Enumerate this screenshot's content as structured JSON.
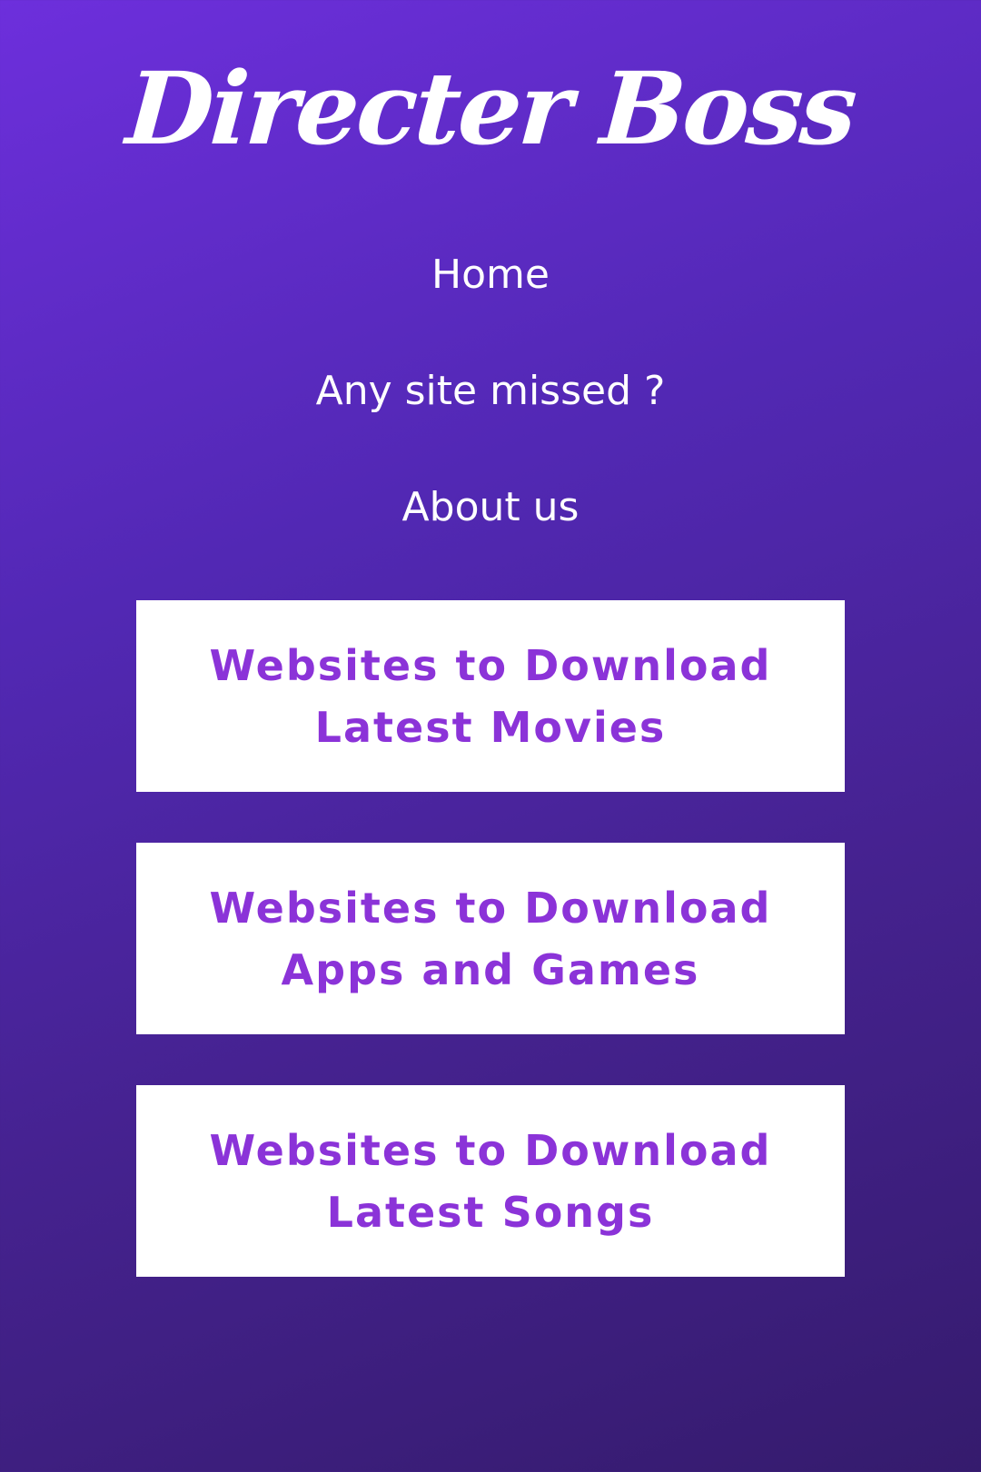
{
  "brand": {
    "title": "Directer Boss"
  },
  "nav": {
    "items": [
      {
        "label": "Home"
      },
      {
        "label": "Any site missed ?"
      },
      {
        "label": "About us"
      }
    ]
  },
  "cards": [
    {
      "label": "Websites to Download Latest Movies"
    },
    {
      "label": "Websites to Download Apps and Games"
    },
    {
      "label": "Websites to Download Latest Songs"
    }
  ],
  "colors": {
    "background_start": "#6d2fdc",
    "background_end": "#351b6d",
    "card_background": "#ffffff",
    "card_text": "#8b33d8",
    "nav_text": "#ffffff"
  }
}
